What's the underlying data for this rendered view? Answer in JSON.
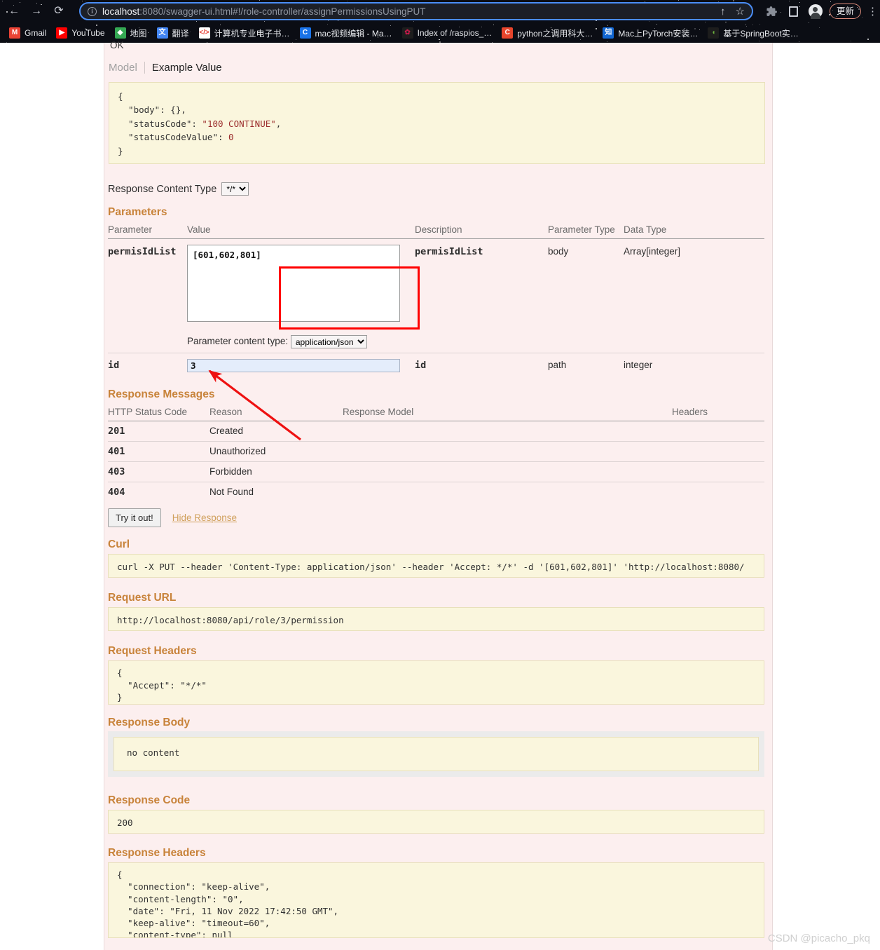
{
  "browser": {
    "nav": {
      "back_icon": "back-arrow-icon",
      "forward_icon": "forward-arrow-icon",
      "reload_icon": "reload-icon"
    },
    "omnibox": {
      "info_glyph": "i",
      "url_host": "localhost",
      "url_rest": ":8080/swagger-ui.html#!/role-controller/assignPermissionsUsingPUT",
      "share_glyph": "↑",
      "bookmark_glyph": "☆"
    },
    "toolbar": {
      "update_label": "更新",
      "menu_glyph": "⋮"
    },
    "bookmarks": [
      {
        "label": "Gmail",
        "icon": "M",
        "fg": "#ffffff",
        "bg": "#ea4335"
      },
      {
        "label": "YouTube",
        "icon": "▶",
        "fg": "#ffffff",
        "bg": "#ff0000"
      },
      {
        "label": "地图",
        "icon": "◆",
        "fg": "#ffffff",
        "bg": "#34a853"
      },
      {
        "label": "翻译",
        "icon": "文",
        "fg": "#ffffff",
        "bg": "#4285f4"
      },
      {
        "label": "计算机专业电子书…",
        "icon": "</>",
        "fg": "#e8453c",
        "bg": "#ffffff"
      },
      {
        "label": "mac视频编辑 - Ma…",
        "icon": "C",
        "fg": "#ffffff",
        "bg": "#1a73e8"
      },
      {
        "label": "Index of /raspios_…",
        "icon": "✿",
        "fg": "#c51a4a",
        "bg": "#1d1d1d"
      },
      {
        "label": "python之调用科大…",
        "icon": "C",
        "fg": "#ffffff",
        "bg": "#e8452c"
      },
      {
        "label": "Mac上PyTorch安装…",
        "icon": "知",
        "fg": "#ffffff",
        "bg": "#1267d3"
      },
      {
        "label": "基于SpringBoot实…",
        "icon": "◖",
        "fg": "#6db33f",
        "bg": "#1d1d1d"
      }
    ]
  },
  "swagger": {
    "ok_label": "OK",
    "model_tabs": {
      "model": "Model",
      "example_value": "Example Value"
    },
    "example_value_code": {
      "line1": "{",
      "line2_key": "  \"body\": {},",
      "line3_key": "  \"statusCode\": ",
      "line3_val": "\"100 CONTINUE\"",
      "line3_tail": ",",
      "line4_key": "  \"statusCodeValue\": ",
      "line4_val": "0",
      "line5": "}"
    },
    "response_content_type": {
      "label": "Response Content Type",
      "selected": "*/*",
      "options": [
        "*/*"
      ]
    },
    "parameters": {
      "title": "Parameters",
      "headers": [
        "Parameter",
        "Value",
        "Description",
        "Parameter Type",
        "Data Type"
      ],
      "rows": [
        {
          "name": "permisIdList",
          "value": "[601,602,801]",
          "description": "permisIdList",
          "param_type": "body",
          "data_type": "Array[integer]",
          "content_type_label": "Parameter content type:",
          "content_type_selected": "application/json",
          "content_type_options": [
            "application/json"
          ]
        },
        {
          "name": "id",
          "value": "3",
          "description": "id",
          "param_type": "path",
          "data_type": "integer"
        }
      ]
    },
    "response_messages": {
      "title": "Response Messages",
      "headers": [
        "HTTP Status Code",
        "Reason",
        "Response Model",
        "Headers"
      ],
      "rows": [
        {
          "code": "201",
          "reason": "Created",
          "model": "",
          "headers": ""
        },
        {
          "code": "401",
          "reason": "Unauthorized",
          "model": "",
          "headers": ""
        },
        {
          "code": "403",
          "reason": "Forbidden",
          "model": "",
          "headers": ""
        },
        {
          "code": "404",
          "reason": "Not Found",
          "model": "",
          "headers": ""
        }
      ]
    },
    "actions": {
      "try_it_out": "Try it out!",
      "hide_response": "Hide Response"
    },
    "curl": {
      "title": "Curl",
      "command": "curl -X PUT --header 'Content-Type: application/json' --header 'Accept: */*' -d '[601,602,801]' 'http://localhost:8080/"
    },
    "request_url": {
      "title": "Request URL",
      "value": "http://localhost:8080/api/role/3/permission"
    },
    "request_headers": {
      "title": "Request Headers",
      "value": "{\n  \"Accept\": \"*/*\"\n}"
    },
    "response_body": {
      "title": "Response Body",
      "value": "no content"
    },
    "response_code": {
      "title": "Response Code",
      "value": "200"
    },
    "response_headers": {
      "title": "Response Headers",
      "value": "{\n  \"connection\": \"keep-alive\",\n  \"content-length\": \"0\",\n  \"date\": \"Fri, 11 Nov 2022 17:42:50 GMT\",\n  \"keep-alive\": \"timeout=60\",\n  \"content-type\": null\n}"
    }
  },
  "annotations": {
    "highlight_color": "#ff0000",
    "watermark": "CSDN @picacho_pkq"
  }
}
